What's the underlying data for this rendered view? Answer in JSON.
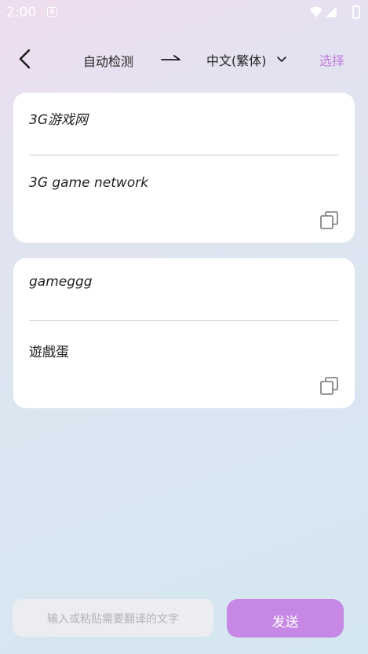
{
  "status_bar": {
    "time": "2:00",
    "notification_icon": "A"
  },
  "header": {
    "source_language": "自动检测",
    "target_language": "中文(繁体)",
    "select_label": "选择"
  },
  "cards": [
    {
      "source_text": "3G游戏网",
      "translation": "3G game network"
    },
    {
      "source_text": "gameggg",
      "translation": "遊戲蛋"
    }
  ],
  "composer": {
    "placeholder": "输入或粘贴需要翻译的文字",
    "send_label": "发送"
  },
  "colors": {
    "accent": "#c688e4",
    "select_text": "#c27ce0",
    "card_bg": "#ffffff"
  },
  "icons": [
    "back-arrow-icon",
    "right-arrow-icon",
    "chevron-down-icon",
    "copy-icon",
    "wifi-icon",
    "signal-icon",
    "battery-icon"
  ]
}
